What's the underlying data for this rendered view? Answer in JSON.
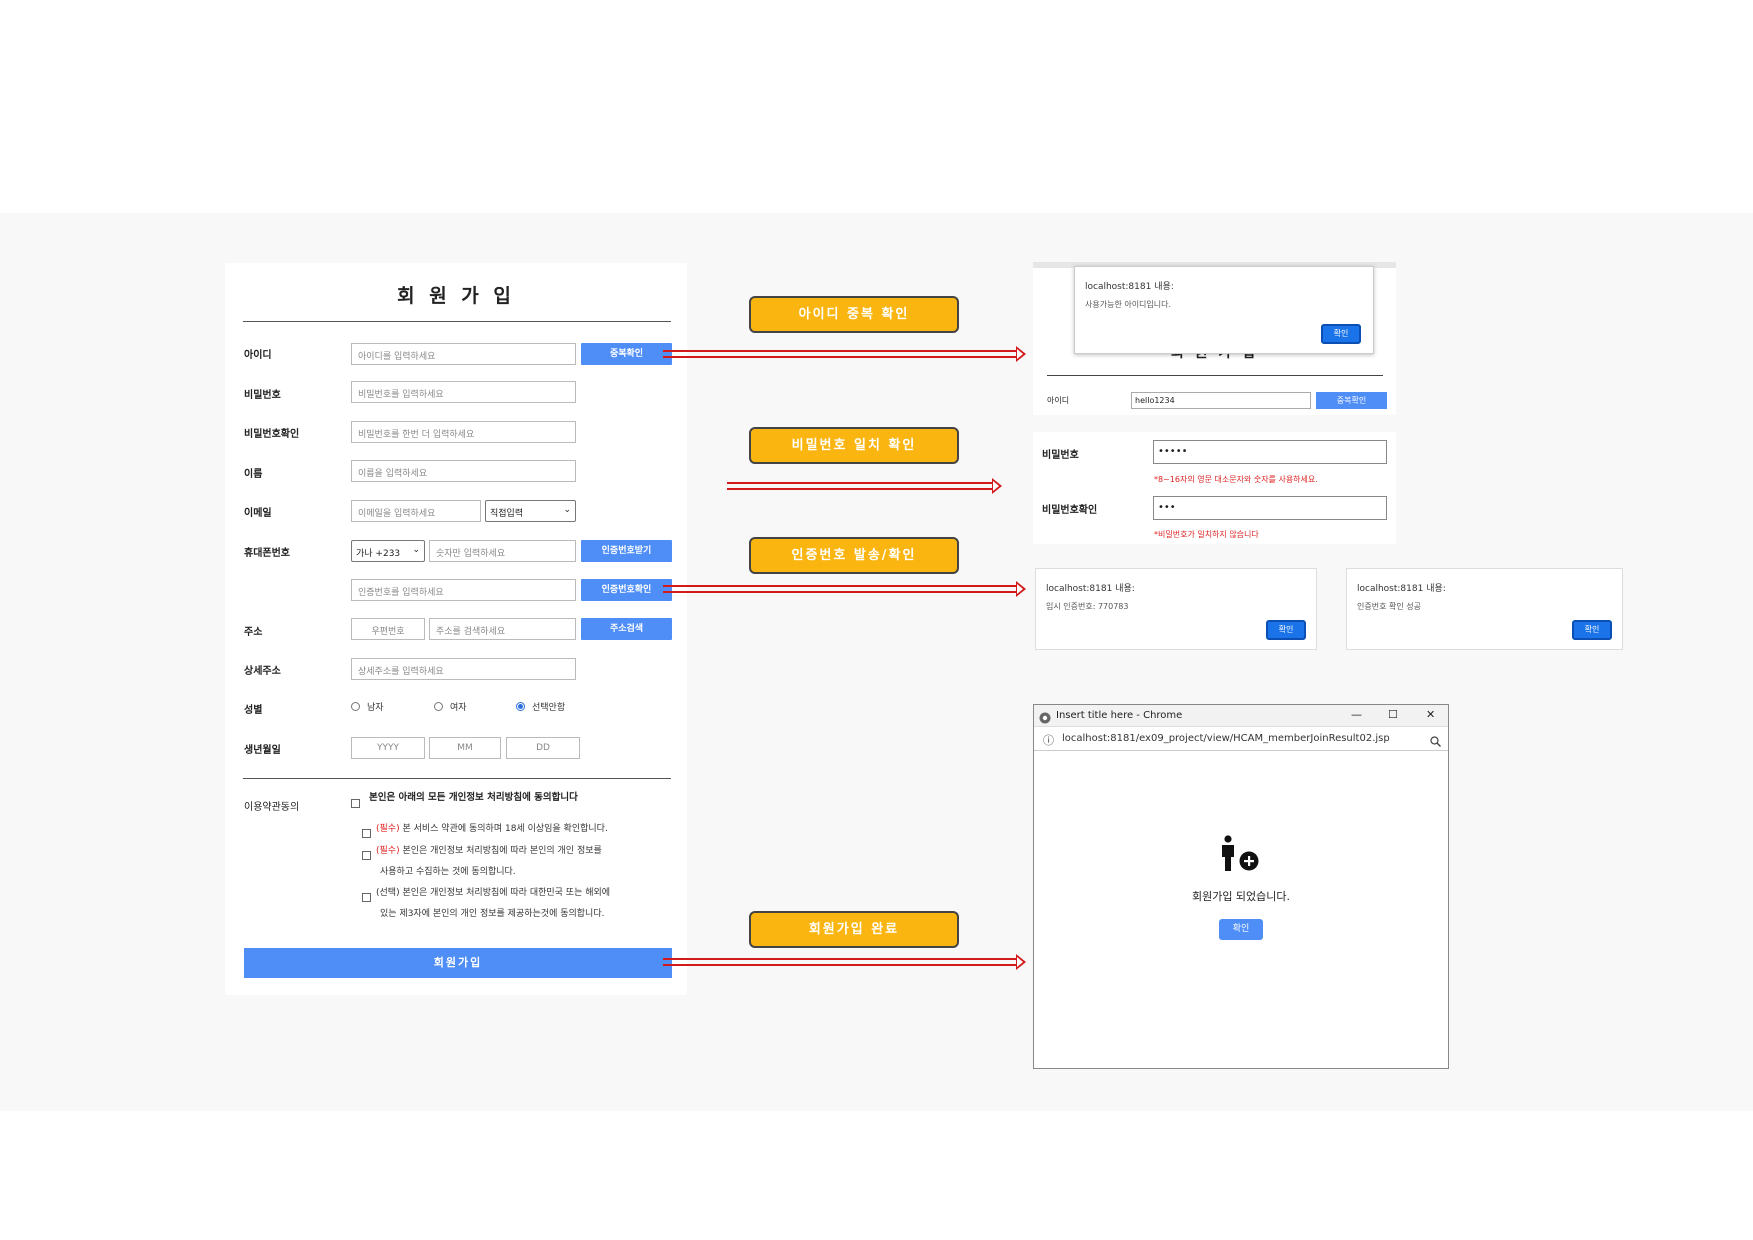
{
  "form": {
    "title": "회 원 가 입",
    "fields": {
      "id": {
        "label": "아이디",
        "placeholder": "아이디를 입력하세요",
        "button": "중복확인"
      },
      "password": {
        "label": "비밀번호",
        "placeholder": "비밀번호를 입력하세요"
      },
      "password_confirm": {
        "label": "비밀번호확인",
        "placeholder": "비밀번호를 한번 더 입력하세요"
      },
      "name": {
        "label": "이름",
        "placeholder": "이름을 입력하세요"
      },
      "email": {
        "label": "이메일",
        "placeholder": "이메일을 입력하세요",
        "domain_select": "직접입력"
      },
      "phone": {
        "label": "휴대폰번호",
        "country_select": "가나 +233",
        "placeholder": "숫자만 입력하세요",
        "button": "인증번호받기"
      },
      "auth_code": {
        "placeholder": "인증번호를 입력하세요",
        "button": "인증번호확인"
      },
      "address": {
        "label": "주소",
        "zip_placeholder": "우편번호",
        "placeholder": "주소를 검색하세요",
        "button": "주소검색"
      },
      "address_detail": {
        "label": "상세주소",
        "placeholder": "상세주소를 입력하세요"
      },
      "gender": {
        "label": "성별",
        "options": [
          "남자",
          "여자",
          "선택안함"
        ],
        "selected": "선택안함"
      },
      "birth": {
        "label": "생년월일",
        "year": "YYYY",
        "month": "MM",
        "day": "DD"
      }
    },
    "terms": {
      "label": "이용약관동의",
      "all": "본인은 아래의 모든 개인정보 처리방침에 동의합니다",
      "items": [
        {
          "tag": "(필수)",
          "text": " 본 서비스 약관에 동의하며 18세 이상임을 확인합니다."
        },
        {
          "tag": "(필수)",
          "text": " 본인은 개인정보 처리방침에 따라 본인의 개인 정보를",
          "text2": "사용하고 수집하는 것에 동의합니다."
        },
        {
          "tag": "(선택)",
          "text": " 본인은 개인정보 처리방침에 따라 대한민국 또는 해외에",
          "text2": "있는 제3자에 본인의 개인 정보를 제공하는것에 동의합니다."
        }
      ]
    },
    "submit": "회원가입"
  },
  "callouts": {
    "id_check": "아이디 중복 확인",
    "pw_match": "비밀번호 일치 확인",
    "auth": "인증번호 발송/확인",
    "join_done": "회원가입 완료"
  },
  "id_check_panel": {
    "alert_header": "localhost:8181 내용:",
    "alert_message": "사용가능한 아이디입니다.",
    "alert_ok": "확인",
    "title": "회 원 가 입",
    "id_label": "아이디",
    "id_value": "hello1234",
    "button": "중복확인"
  },
  "password_panel": {
    "pw_label": "비밀번호",
    "pw_value": "•••••",
    "pw_error": "*8~16자의 영문 대소문자와 숫자를 사용하세요.",
    "confirm_label": "비밀번호확인",
    "confirm_value": "•••",
    "confirm_error": "*비밀번호가 일치하지 않습니다"
  },
  "auth_send_dialog": {
    "header": "localhost:8181 내용:",
    "message": "임시 인증번호: 770783",
    "ok": "확인"
  },
  "auth_confirm_dialog": {
    "header": "localhost:8181 내용:",
    "message": "인증번호 확인 성공",
    "ok": "확인"
  },
  "result_window": {
    "title": "Insert title here - Chrome",
    "url": "localhost:8181/ex09_project/view/HCAM_memberJoinResult02.jsp",
    "message": "회원가입 되었습니다.",
    "ok": "확인"
  },
  "colors": {
    "primary": "#4f8ef7",
    "callout": "#fbb510",
    "arrow": "#d31a1a",
    "error": "#dd2222"
  }
}
